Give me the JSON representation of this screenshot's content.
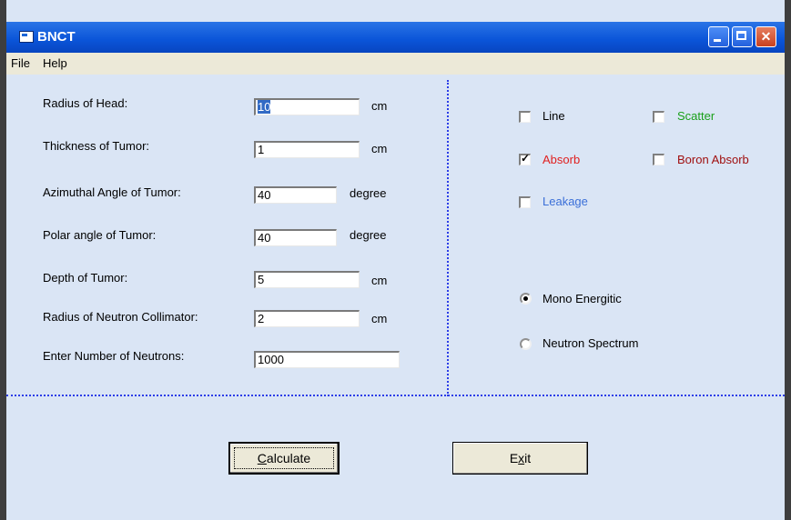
{
  "window": {
    "title": "BNCT",
    "colors": {
      "titlebar": "#0a54d8",
      "client": "#dae5f5",
      "divider": "#2c3de8"
    },
    "controls": [
      "minimize-icon",
      "maximize-icon",
      "close-icon"
    ]
  },
  "menu": {
    "file": "File",
    "help": "Help"
  },
  "inputs": [
    {
      "label": "Radius of Head:",
      "value": "10",
      "unit": "cm"
    },
    {
      "label": "Thickness of Tumor:",
      "value": "1",
      "unit": "cm"
    },
    {
      "label": "Azimuthal Angle of Tumor:",
      "value": "40",
      "unit": "degree"
    },
    {
      "label": "Polar angle of Tumor:",
      "value": "40",
      "unit": "degree"
    },
    {
      "label": "Depth of Tumor:",
      "value": "5",
      "unit": "cm"
    },
    {
      "label": "Radius of Neutron Collimator:",
      "value": "2",
      "unit": "cm"
    },
    {
      "label": "Enter Number of Neutrons:",
      "value": "1000"
    }
  ],
  "checkboxes": [
    {
      "label": "Line",
      "checked": false,
      "color": "#000000"
    },
    {
      "label": "Scatter",
      "checked": false,
      "color": "#1aa01a"
    },
    {
      "label": "Absorb",
      "checked": true,
      "color": "#e02020"
    },
    {
      "label": "Boron Absorb",
      "checked": false,
      "color": "#a01010"
    },
    {
      "label": "Leakage",
      "checked": false,
      "color": "#3a6fd8"
    }
  ],
  "radios": [
    {
      "label": "Mono Energitic",
      "checked": true
    },
    {
      "label": "Neutron Spectrum",
      "checked": false
    }
  ],
  "buttons": {
    "calculate": {
      "pre": "",
      "key": "C",
      "post": "alculate"
    },
    "exit": {
      "pre": "E",
      "key": "x",
      "post": "it"
    }
  }
}
